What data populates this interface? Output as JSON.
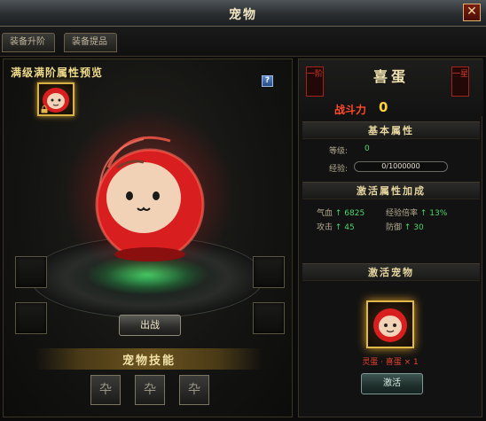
{
  "window": {
    "title": "宠物",
    "close_label": "✕"
  },
  "tabs": [
    {
      "label": "装备升阶"
    },
    {
      "label": "装备提品"
    }
  ],
  "preview": {
    "title": "满级满阶属性预览",
    "help_label": "?",
    "deploy_label": "出战",
    "skill_title": "宠物技能",
    "skill_slots": [
      "卆",
      "卆",
      "卆"
    ]
  },
  "pet": {
    "name": "喜蛋",
    "rank_left": "一阶",
    "rank_right": "一星",
    "power_label": "战斗力",
    "power_value": "0"
  },
  "basic": {
    "header": "基本属性",
    "level_label": "等级:",
    "level_value": "0",
    "exp_label": "经验:",
    "exp_value": "0/1000000"
  },
  "activate_attrs": {
    "header": "激活属性加成",
    "rows": [
      {
        "name": "气血",
        "value": "↑ 6825"
      },
      {
        "name": "经验倍率",
        "value": "↑ 13%"
      },
      {
        "name": "攻击",
        "value": "↑ 45"
      },
      {
        "name": "防御",
        "value": "↑ 30"
      }
    ]
  },
  "activate_pet": {
    "header": "激活宠物",
    "cost": "灵蛋 · 喜蛋 × 1",
    "button": "激活"
  },
  "colors": {
    "gold": "#f0dc8a",
    "green_value": "#4cd66a",
    "power_red": "#ff4a2a",
    "power_yellow": "#ffd23a",
    "pet_red": "#d81e1e"
  },
  "icons": {
    "help": "help-icon",
    "close": "close-icon",
    "lock": "lock-icon",
    "skill": "skill-slot-icon"
  }
}
